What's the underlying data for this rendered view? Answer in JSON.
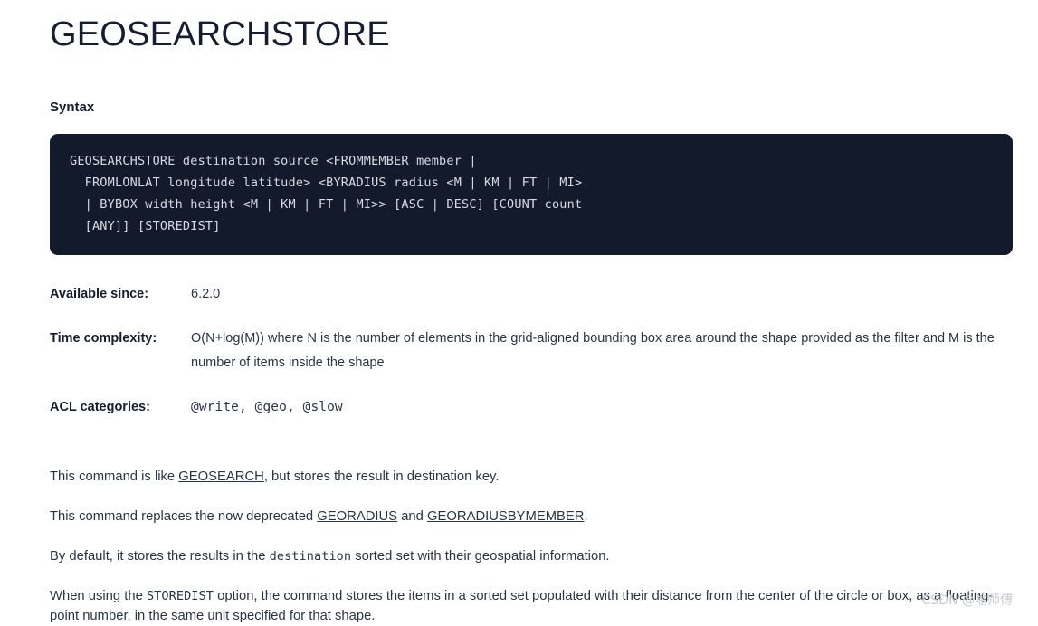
{
  "page": {
    "title": "GEOSEARCHSTORE",
    "syntax_heading": "Syntax",
    "syntax_code": "GEOSEARCHSTORE destination source <FROMMEMBER member |\n  FROMLONLAT longitude latitude> <BYRADIUS radius <M | KM | FT | MI>\n  | BYBOX width height <M | KM | FT | MI>> [ASC | DESC] [COUNT count\n  [ANY]] [STOREDIST]"
  },
  "meta": {
    "rows": [
      {
        "label": "Available since:",
        "value": "6.2.0",
        "mono": false
      },
      {
        "label": "Time complexity:",
        "value": "O(N+log(M)) where N is the number of elements in the grid-aligned bounding box area around the shape provided as the filter and M is the number of items inside the shape",
        "mono": false
      },
      {
        "label": "ACL categories:",
        "value": "@write, @geo, @slow",
        "mono": true
      }
    ]
  },
  "paragraphs": {
    "p1": {
      "before": "This command is like ",
      "link": "GEOSEARCH",
      "after": ", but stores the result in destination key."
    },
    "p2": {
      "before": "This command replaces the now deprecated ",
      "link1": "GEORADIUS",
      "middle": " and ",
      "link2": "GEORADIUSBYMEMBER",
      "after": "."
    },
    "p3": {
      "before": "By default, it stores the results in the ",
      "code": "destination",
      "after": " sorted set with their geospatial information."
    },
    "p4": {
      "before": "When using the ",
      "code": "STOREDIST",
      "after": " option, the command stores the items in a sorted set populated with their distance from the center of the circle or box, as a floating-point number, in the same unit specified for that shape."
    }
  },
  "watermark": {
    "text": "CSDN @喻师傅"
  },
  "colors": {
    "code_background": "#131a2b",
    "code_text": "#d6dae4",
    "heading": "#161d2f",
    "body": "#2b3445",
    "watermark": "#c6c9cf",
    "page_background": "#ffffff"
  }
}
